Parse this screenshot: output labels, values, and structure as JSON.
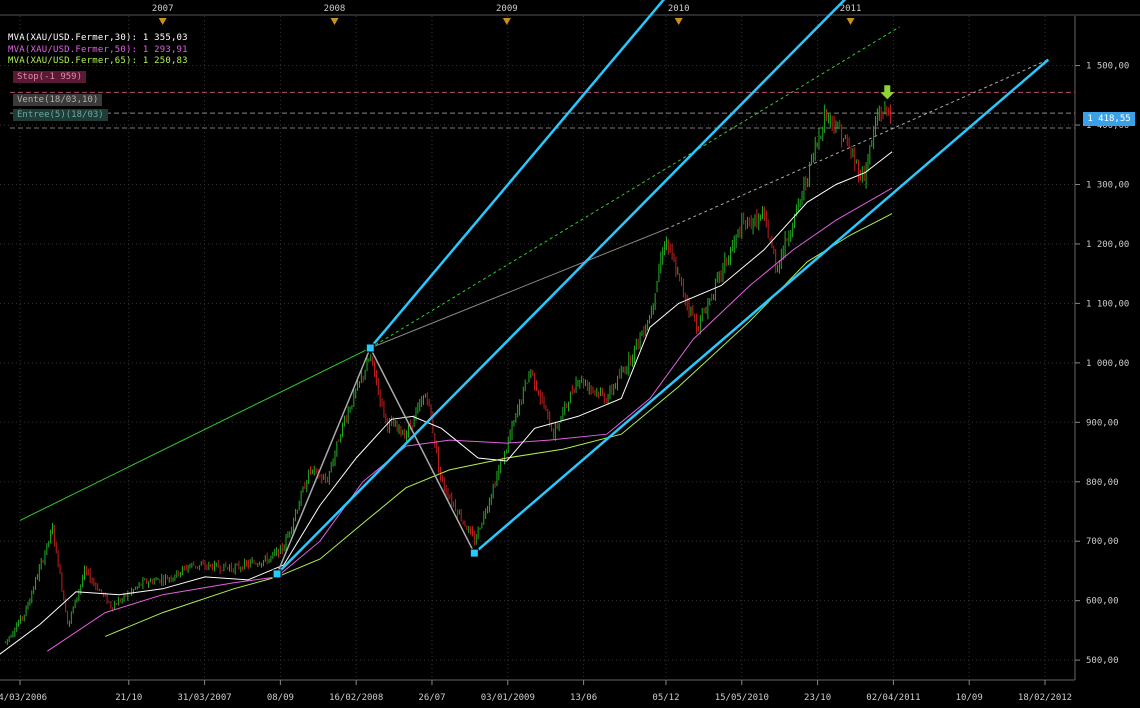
{
  "chart_data": {
    "type": "candlestick",
    "instrument": "XAU/USD",
    "y_ticks": [
      "1 500,00",
      "1 400,00",
      "1 300,00",
      "1 200,00",
      "1 100,00",
      "1 000,00",
      "900,00",
      "800,00",
      "700,00",
      "600,00",
      "500,00"
    ],
    "y_tick_values": [
      1500,
      1400,
      1300,
      1200,
      1100,
      1000,
      900,
      800,
      700,
      600,
      500
    ],
    "ylim": [
      475,
      1580
    ],
    "x_ticks": [
      "04/03/2006",
      "21/10",
      "31/03/2007",
      "08/09",
      "16/02/2008",
      "26/07",
      "03/01/2009",
      "13/06",
      "05/12",
      "15/05/2010",
      "23/10",
      "02/04/2011",
      "10/09",
      "18/02/2012"
    ],
    "x_tick_dates": [
      "2006-03-04",
      "2006-10-21",
      "2007-03-31",
      "2007-09-08",
      "2008-02-16",
      "2008-07-26",
      "2009-01-03",
      "2009-06-13",
      "2009-12-05",
      "2010-05-15",
      "2010-10-23",
      "2011-04-02",
      "2011-09-10",
      "2012-02-18"
    ],
    "year_markers": [
      "2007",
      "2008",
      "2009",
      "2010",
      "2011"
    ],
    "year_marker_dates": [
      "2007-01-01",
      "2008-01-01",
      "2009-01-01",
      "2010-01-01",
      "2011-01-01"
    ],
    "price_path": [
      [
        "2006-02-01",
        530
      ],
      [
        "2006-03-15",
        580
      ],
      [
        "2006-05-12",
        720
      ],
      [
        "2006-06-14",
        560
      ],
      [
        "2006-07-20",
        650
      ],
      [
        "2006-09-15",
        590
      ],
      [
        "2006-11-20",
        630
      ],
      [
        "2007-01-20",
        640
      ],
      [
        "2007-03-01",
        660
      ],
      [
        "2007-06-01",
        655
      ],
      [
        "2007-08-15",
        670
      ],
      [
        "2007-09-15",
        690
      ],
      [
        "2007-11-10",
        820
      ],
      [
        "2007-12-15",
        800
      ],
      [
        "2008-01-20",
        900
      ],
      [
        "2008-03-17",
        1010
      ],
      [
        "2008-04-20",
        900
      ],
      [
        "2008-06-01",
        880
      ],
      [
        "2008-07-15",
        950
      ],
      [
        "2008-08-15",
        800
      ],
      [
        "2008-10-24",
        700
      ],
      [
        "2008-11-20",
        760
      ],
      [
        "2009-01-01",
        860
      ],
      [
        "2009-02-20",
        990
      ],
      [
        "2009-04-10",
        880
      ],
      [
        "2009-06-01",
        975
      ],
      [
        "2009-08-01",
        940
      ],
      [
        "2009-09-15",
        1000
      ],
      [
        "2009-11-01",
        1080
      ],
      [
        "2009-12-03",
        1210
      ],
      [
        "2010-01-10",
        1120
      ],
      [
        "2010-02-10",
        1060
      ],
      [
        "2010-03-15",
        1120
      ],
      [
        "2010-05-15",
        1230
      ],
      [
        "2010-07-01",
        1245
      ],
      [
        "2010-07-28",
        1160
      ],
      [
        "2010-09-15",
        1270
      ],
      [
        "2010-11-09",
        1420
      ],
      [
        "2010-12-10",
        1390
      ],
      [
        "2011-01-28",
        1310
      ],
      [
        "2011-03-01",
        1420
      ],
      [
        "2011-03-22",
        1425
      ],
      [
        "2011-03-30",
        1418.55
      ]
    ],
    "series": [
      {
        "name": "MVA(XAU/USD.Fermer,30)",
        "last": "1 355,03",
        "color": "#ffffff"
      },
      {
        "name": "MVA(XAU/USD.Fermer,50)",
        "last": "1 293,91",
        "color": "#e060e0"
      },
      {
        "name": "MVA(XAU/USD.Fermer,65)",
        "last": "1 250,83",
        "color": "#b0f050"
      }
    ],
    "ma_values": {
      "ma30": [
        [
          "2006-01-20",
          510
        ],
        [
          "2006-04-15",
          560
        ],
        [
          "2006-07-01",
          615
        ],
        [
          "2006-10-01",
          610
        ],
        [
          "2007-01-01",
          620
        ],
        [
          "2007-04-01",
          640
        ],
        [
          "2007-07-01",
          635
        ],
        [
          "2007-09-15",
          660
        ],
        [
          "2007-12-01",
          760
        ],
        [
          "2008-02-16",
          840
        ],
        [
          "2008-05-01",
          905
        ],
        [
          "2008-06-15",
          910
        ],
        [
          "2008-08-15",
          890
        ],
        [
          "2008-11-01",
          840
        ],
        [
          "2009-01-01",
          835
        ],
        [
          "2009-03-01",
          890
        ],
        [
          "2009-06-01",
          910
        ],
        [
          "2009-09-01",
          940
        ],
        [
          "2009-11-01",
          1060
        ],
        [
          "2010-01-01",
          1100
        ],
        [
          "2010-04-01",
          1130
        ],
        [
          "2010-07-01",
          1190
        ],
        [
          "2010-10-01",
          1270
        ],
        [
          "2010-12-01",
          1300
        ],
        [
          "2011-02-01",
          1320
        ],
        [
          "2011-03-30",
          1355
        ]
      ],
      "ma50": [
        [
          "2006-05-01",
          515
        ],
        [
          "2006-09-01",
          580
        ],
        [
          "2007-01-01",
          610
        ],
        [
          "2007-06-01",
          630
        ],
        [
          "2007-09-01",
          640
        ],
        [
          "2007-12-01",
          700
        ],
        [
          "2008-03-01",
          800
        ],
        [
          "2008-06-01",
          860
        ],
        [
          "2008-09-01",
          870
        ],
        [
          "2009-01-01",
          865
        ],
        [
          "2009-04-01",
          870
        ],
        [
          "2009-08-01",
          880
        ],
        [
          "2009-11-01",
          940
        ],
        [
          "2010-02-01",
          1040
        ],
        [
          "2010-06-01",
          1130
        ],
        [
          "2010-09-01",
          1190
        ],
        [
          "2010-12-01",
          1240
        ],
        [
          "2011-03-30",
          1294
        ]
      ],
      "ma65": [
        [
          "2006-09-01",
          540
        ],
        [
          "2007-01-01",
          580
        ],
        [
          "2007-06-01",
          620
        ],
        [
          "2007-09-01",
          640
        ],
        [
          "2007-12-01",
          670
        ],
        [
          "2008-03-01",
          730
        ],
        [
          "2008-06-01",
          790
        ],
        [
          "2008-09-01",
          820
        ],
        [
          "2009-01-01",
          840
        ],
        [
          "2009-05-01",
          855
        ],
        [
          "2009-09-01",
          880
        ],
        [
          "2010-01-01",
          960
        ],
        [
          "2010-06-01",
          1070
        ],
        [
          "2010-10-01",
          1170
        ],
        [
          "2011-01-01",
          1215
        ],
        [
          "2011-03-30",
          1251
        ]
      ]
    },
    "pivots": [
      {
        "date": "2007-09-01",
        "value": 645
      },
      {
        "date": "2008-03-17",
        "value": 1025
      },
      {
        "date": "2008-10-24",
        "value": 680
      }
    ],
    "channel_lines": [
      {
        "from": [
          "2008-03-17",
          1025
        ],
        "to": [
          "2009-12-31",
          1640
        ],
        "color": "#29c8ff"
      },
      {
        "from": [
          "2007-09-01",
          645
        ],
        "to": [
          "2011-01-25",
          1640
        ],
        "color": "#29c8ff"
      },
      {
        "from": [
          "2008-10-24",
          680
        ],
        "to": [
          "2012-02-25",
          1510
        ],
        "color": "#29c8ff"
      }
    ],
    "trend_lines": [
      {
        "from": [
          "2006-03-04",
          735
        ],
        "to": [
          "2008-03-17",
          1025
        ],
        "color": "#2ecc2e",
        "style": "solid"
      },
      {
        "from": [
          "2008-03-17",
          1025
        ],
        "to": [
          "2011-04-15",
          1565
        ],
        "color": "#2ecc2e",
        "style": "dashed"
      },
      {
        "from": [
          "2008-03-17",
          1025
        ],
        "to": [
          "2009-12-05",
          1225
        ],
        "color": "#888888",
        "style": "solid"
      },
      {
        "from": [
          "2009-12-05",
          1225
        ],
        "to": [
          "2012-02-25",
          1510
        ],
        "color": "#aaaaaa",
        "style": "dashed"
      }
    ],
    "levels": [
      {
        "name": "stop",
        "value": 1455,
        "color": "#b05070"
      },
      {
        "name": "entry",
        "value": 1420,
        "color": "#888888"
      },
      {
        "name": "current",
        "value": 1395,
        "color": "#777777"
      }
    ],
    "signal": {
      "type": "sell-arrow",
      "date": "2011-03-20",
      "value": 1450,
      "color": "#8cd630"
    },
    "last_price": "1 418,55",
    "annotations": [
      {
        "text": "Stop(-1 959)",
        "bg": "#5a1a35",
        "fg": "#e08aaa"
      },
      {
        "text": "Vente(18/03,10)",
        "bg": "#3a3a3a",
        "fg": "#b0b0b0"
      },
      {
        "text": "Entree(5)(18/03)",
        "bg": "#1e3c38",
        "fg": "#70a8a0"
      }
    ]
  }
}
